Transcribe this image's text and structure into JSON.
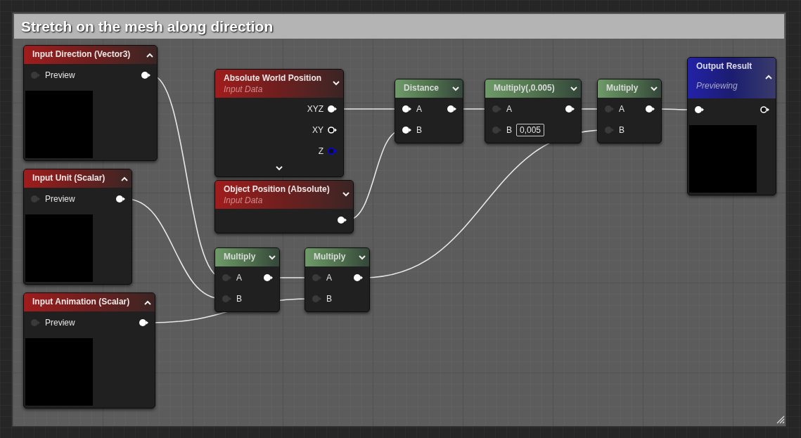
{
  "comment_box": {
    "title": "Stretch on the mesh along direction"
  },
  "nodes": [
    {
      "kind": "input",
      "title": "Input Direction (Vector3)",
      "expanded": true,
      "preview": true,
      "rows": [
        {
          "in": {
            "label": "Preview",
            "connected": false
          },
          "out": {
            "connected": true
          }
        }
      ]
    },
    {
      "kind": "input",
      "title": "Input Unit (Scalar)",
      "expanded": true,
      "preview": true,
      "rows": [
        {
          "in": {
            "label": "Preview",
            "connected": false
          },
          "out": {
            "connected": true
          }
        }
      ]
    },
    {
      "kind": "input",
      "title": "Input Animation (Scalar)",
      "expanded": true,
      "preview": true,
      "rows": [
        {
          "in": {
            "label": "Preview",
            "connected": false
          },
          "out": {
            "connected": true
          }
        }
      ]
    },
    {
      "kind": "input",
      "title": "Absolute World Position",
      "subtitle": "Input Data",
      "expanded": false,
      "show_advanced": false,
      "rows": [
        {
          "out": {
            "label": "XYZ",
            "connected": true
          }
        },
        {
          "out": {
            "label": "XY",
            "connected": false
          }
        },
        {
          "out": {
            "label": "Z",
            "connected": false,
            "color": "#0000ff"
          }
        }
      ]
    },
    {
      "kind": "input",
      "title": "Object Position (Absolute)",
      "subtitle": "Input Data",
      "expanded": false,
      "rows": [
        {
          "out": {
            "connected": true
          }
        }
      ]
    },
    {
      "kind": "math",
      "title": "Distance",
      "expanded": false,
      "rows": [
        {
          "in": {
            "label": "A",
            "connected": true
          },
          "out": {
            "connected": true
          }
        },
        {
          "in": {
            "label": "B",
            "connected": true
          }
        }
      ]
    },
    {
      "kind": "math",
      "title": "Multiply(,0.005)",
      "expanded": false,
      "rows": [
        {
          "in": {
            "label": "A",
            "connected": false
          },
          "out": {
            "connected": true
          }
        },
        {
          "in": {
            "label": "B",
            "connected": false,
            "value": "0,005"
          }
        }
      ]
    },
    {
      "kind": "math",
      "title": "Multiply",
      "expanded": false,
      "rows": [
        {
          "in": {
            "label": "A",
            "connected": false
          },
          "out": {
            "connected": true
          }
        },
        {
          "in": {
            "label": "B",
            "connected": false
          }
        }
      ]
    },
    {
      "kind": "output",
      "title": "Output Result",
      "subtitle": "Previewing",
      "expanded": true,
      "preview": true,
      "rows": [
        {
          "in": {
            "connected": true
          },
          "out": {
            "connected": false
          }
        }
      ]
    },
    {
      "kind": "math",
      "title": "Multiply",
      "expanded": false,
      "rows": [
        {
          "in": {
            "label": "A",
            "connected": false
          },
          "out": {
            "connected": true
          }
        },
        {
          "in": {
            "label": "B",
            "connected": false
          }
        }
      ]
    },
    {
      "kind": "math",
      "title": "Multiply",
      "expanded": false,
      "rows": [
        {
          "in": {
            "label": "A",
            "connected": false
          },
          "out": {
            "connected": true
          }
        },
        {
          "in": {
            "label": "B",
            "connected": false
          }
        }
      ]
    }
  ]
}
